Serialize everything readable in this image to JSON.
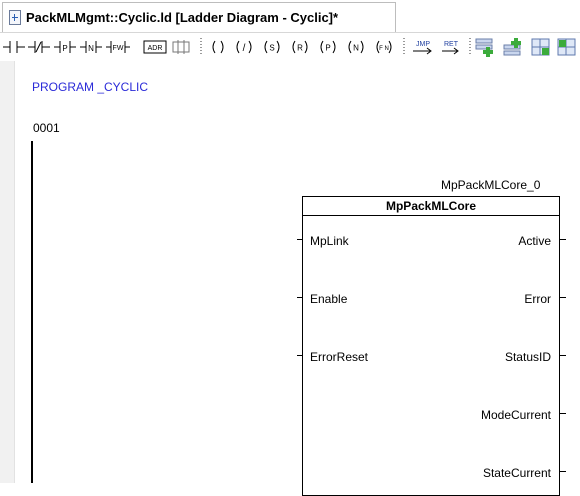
{
  "tab": {
    "title": "PackMLMgmt::Cyclic.ld [Ladder Diagram - Cyclic]*"
  },
  "toolbar": {
    "buttons": [
      {
        "name": "contact-no-icon",
        "label": ""
      },
      {
        "name": "contact-nc-icon",
        "label": ""
      },
      {
        "name": "contact-p-icon",
        "label": "P"
      },
      {
        "name": "contact-n-icon",
        "label": "N"
      },
      {
        "name": "contact-fw-icon",
        "label": "FW"
      },
      {
        "name": "contact-adr-icon",
        "label": "ADR"
      },
      {
        "name": "contact-branch-icon",
        "label": ""
      },
      {
        "name": "coil-icon",
        "label": ""
      },
      {
        "name": "coil-negated-icon",
        "label": "/"
      },
      {
        "name": "coil-set-icon",
        "label": "S"
      },
      {
        "name": "coil-reset-icon",
        "label": "R"
      },
      {
        "name": "coil-p-icon",
        "label": "P"
      },
      {
        "name": "coil-n-icon",
        "label": "N"
      },
      {
        "name": "coil-fn-icon",
        "label": "F N"
      },
      {
        "name": "jump-icon",
        "label": "JMP"
      },
      {
        "name": "return-icon",
        "label": "RET"
      },
      {
        "name": "add-network-above-icon",
        "label": ""
      },
      {
        "name": "add-network-below-icon",
        "label": ""
      },
      {
        "name": "add-block-icon",
        "label": ""
      },
      {
        "name": "add-block-alt-icon",
        "label": ""
      }
    ]
  },
  "editor": {
    "program_line": "PROGRAM _CYCLIC",
    "network_number": "0001",
    "block": {
      "instance": "MpPackMLCore_0",
      "type": "MpPackMLCore",
      "inputs": [
        "MpLink",
        "Enable",
        "ErrorReset"
      ],
      "outputs": [
        "Active",
        "Error",
        "StatusID",
        "ModeCurrent",
        "StateCurrent"
      ]
    }
  }
}
